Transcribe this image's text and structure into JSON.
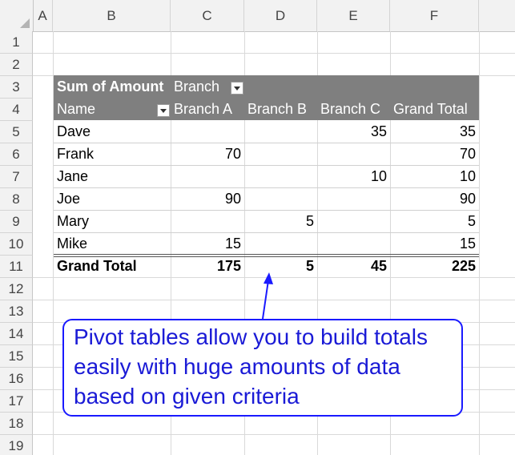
{
  "columns": [
    "A",
    "B",
    "C",
    "D",
    "E",
    "F"
  ],
  "rows": [
    "1",
    "2",
    "3",
    "4",
    "5",
    "6",
    "7",
    "8",
    "9",
    "10",
    "11",
    "12",
    "13",
    "14",
    "15",
    "16",
    "17",
    "18",
    "19"
  ],
  "pivot": {
    "value_field": "Sum of Amount",
    "column_field": "Branch",
    "row_field": "Name",
    "column_headers": [
      "Branch A",
      "Branch B",
      "Branch C",
      "Grand Total"
    ],
    "rows": [
      {
        "name": "Dave",
        "branch_a": "",
        "branch_b": "",
        "branch_c": "35",
        "total": "35"
      },
      {
        "name": "Frank",
        "branch_a": "70",
        "branch_b": "",
        "branch_c": "",
        "total": "70"
      },
      {
        "name": "Jane",
        "branch_a": "",
        "branch_b": "",
        "branch_c": "10",
        "total": "10"
      },
      {
        "name": "Joe",
        "branch_a": "90",
        "branch_b": "",
        "branch_c": "",
        "total": "90"
      },
      {
        "name": "Mary",
        "branch_a": "",
        "branch_b": "5",
        "branch_c": "",
        "total": "5"
      },
      {
        "name": "Mike",
        "branch_a": "15",
        "branch_b": "",
        "branch_c": "",
        "total": "15"
      }
    ],
    "grand_total": {
      "label": "Grand Total",
      "branch_a": "175",
      "branch_b": "5",
      "branch_c": "45",
      "total": "225"
    }
  },
  "callout": {
    "text": "Pivot tables allow you to build totals easily with huge amounts of data based on given criteria",
    "color": "#1a1ad6",
    "border_color": "#1a1aff"
  },
  "colors": {
    "pivot_header": "#7f7f7f",
    "grid": "#d9d9d9",
    "header_bg": "#f2f2f2"
  }
}
